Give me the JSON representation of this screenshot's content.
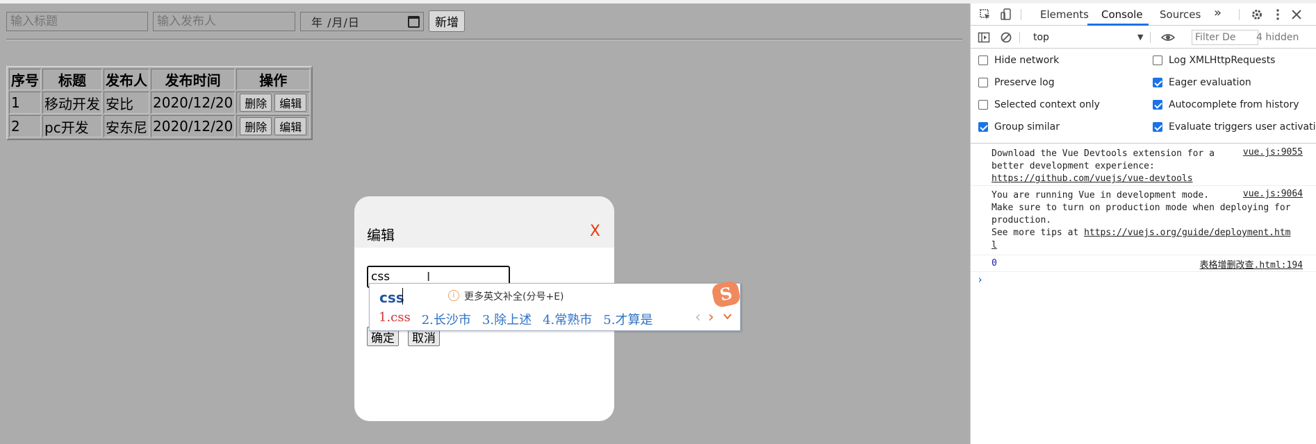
{
  "form": {
    "title_placeholder": "输入标题",
    "publisher_placeholder": "输入发布人",
    "date_placeholder": "年 /月/日",
    "add_label": "新增"
  },
  "table": {
    "headers": [
      "序号",
      "标题",
      "发布人",
      "发布时间",
      "操作"
    ],
    "rows": [
      {
        "index": "1",
        "title": "移动开发",
        "publisher": "安比",
        "date": "2020/12/20"
      },
      {
        "index": "2",
        "title": "pc开发",
        "publisher": "安东尼",
        "date": "2020/12/20"
      }
    ],
    "delete_label": "删除",
    "edit_label": "编辑"
  },
  "modal": {
    "title": "编辑",
    "close_label": "X",
    "input_value": "css",
    "confirm_label": "确定",
    "cancel_label": "取消"
  },
  "ime": {
    "composition": "css",
    "info_icon": "i",
    "hint": "更多英文补全(分号+E)",
    "logo": "S",
    "candidates": [
      "1.css",
      "2.长沙市",
      "3.除上述",
      "4.常熟市",
      "5.才算是"
    ],
    "prev": "‹",
    "next": "›"
  },
  "devtools": {
    "tabs": [
      "Elements",
      "Console",
      "Sources"
    ],
    "more_tabs": "»",
    "context": "top",
    "filter_placeholder": "Filter",
    "filter_suffix": "De",
    "hidden_count": "4 hidden",
    "settings": [
      {
        "label": "Hide network",
        "checked": false
      },
      {
        "label": "Log XMLHttpRequests",
        "checked": false
      },
      {
        "label": "Preserve log",
        "checked": false
      },
      {
        "label": "Eager evaluation",
        "checked": true
      },
      {
        "label": "Selected context only",
        "checked": false
      },
      {
        "label": "Autocomplete from history",
        "checked": true
      },
      {
        "label": "Group similar",
        "checked": true
      },
      {
        "label": "Evaluate triggers user activation",
        "checked": true
      }
    ],
    "messages": [
      {
        "lines": [
          "Download the Vue Devtools extension for a",
          "better development experience:"
        ],
        "link": "https://github.com/vuejs/vue-devtools",
        "source": "vue.js:9055"
      },
      {
        "lines": [
          "You are running Vue in development mode.",
          "Make sure to turn on production mode when deploying for",
          "production.",
          "See more tips at "
        ],
        "link": "https://vuejs.org/guide/deployment.htm",
        "link_cont": "l",
        "source": "vue.js:9064"
      },
      {
        "value": "0",
        "source": "表格增删改查.html:194"
      }
    ],
    "prompt": "›"
  },
  "colors": {
    "page_bg": "#acacac",
    "close_x": "#e8380d",
    "devtools_accent": "#1a73e8",
    "ime_selected": "#d23232",
    "ime_candidate": "#2f72c4"
  }
}
